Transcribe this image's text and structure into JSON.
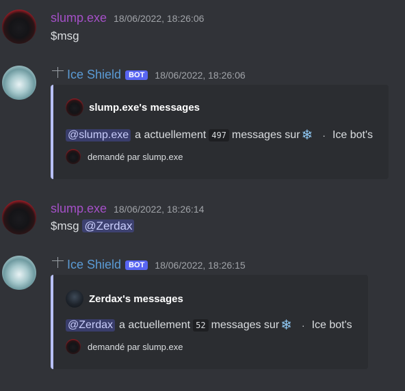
{
  "messages": [
    {
      "author": "slump.exe",
      "timestamp": "18/06/2022, 18:26:06",
      "text": "$msg"
    },
    {
      "author": "Ice Shield",
      "badge": "BOT",
      "timestamp": "18/06/2022, 18:26:06",
      "embed": {
        "title": "slump.exe's messages",
        "mention": "@slump.exe",
        "text_before": "a actuellement",
        "count": "497",
        "text_after": "messages sur",
        "emoji": "❄",
        "separator": "·",
        "server": "Ice bot's",
        "footer": "demandé par slump.exe"
      }
    },
    {
      "author": "slump.exe",
      "timestamp": "18/06/2022, 18:26:14",
      "text": "$msg",
      "mention": "@Zerdax"
    },
    {
      "author": "Ice Shield",
      "badge": "BOT",
      "timestamp": "18/06/2022, 18:26:15",
      "embed": {
        "title": "Zerdax's messages",
        "mention": "@Zerdax",
        "text_before": "a actuellement",
        "count": "52",
        "text_after": "messages sur",
        "emoji": "❄",
        "separator": "·",
        "server": "Ice bot's",
        "footer": "demandé par slump.exe"
      }
    }
  ],
  "colors": {
    "background": "#313338",
    "user_name": "#a550c8",
    "bot_name": "#5b9bd5",
    "bot_badge": "#5865f2",
    "embed_bg": "#2b2d31",
    "embed_border": "#b8c0f6",
    "mention_bg": "rgba(88,101,242,0.3)"
  },
  "icons": [
    "avatar-shadow",
    "avatar-ice-shield",
    "reply-pin-icon",
    "snowflake-emoji"
  ]
}
